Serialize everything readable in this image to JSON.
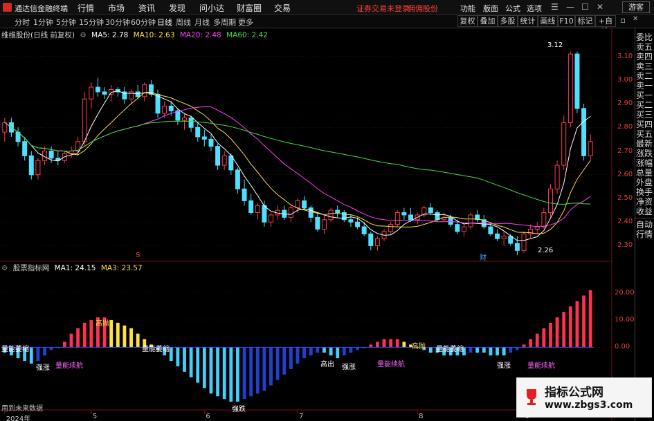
{
  "titlebar": {
    "app_title": "通达信金融终端",
    "menus": [
      "行情",
      "市场",
      "资讯",
      "发现",
      "问小达",
      "财富圈",
      "交易"
    ],
    "warning": "证券交易未登录",
    "broker": "佣佣股份",
    "right_menus": [
      "功能",
      "版面",
      "公式",
      "选项"
    ],
    "guest": "游客"
  },
  "toolbar": {
    "periods": [
      "分时",
      "1分钟",
      "5分钟",
      "15分钟",
      "30分钟",
      "60分钟",
      "日线",
      "周线",
      "月线",
      "多周期",
      "更多"
    ],
    "active_period": "日线",
    "buttons": [
      "复权",
      "叠加",
      "多股",
      "统计",
      "画线",
      "F10",
      "标记",
      "+自选"
    ]
  },
  "main_legend": {
    "stock": "维维股份(日线 前复权)",
    "ma5": "MA5: 2.78",
    "ma10": "MA10: 2.63",
    "ma20": "MA20: 2.48",
    "ma60": "MA60: 2.42"
  },
  "sub_legend": {
    "name": "股票指标网",
    "ma1": "MA1: 24.15",
    "ma3": "MA3: 23.57"
  },
  "price_axis": [
    "3.10",
    "3.00",
    "2.90",
    "2.80",
    "2.70",
    "2.60",
    "2.50",
    "2.40",
    "2.30"
  ],
  "indicator_axis": [
    "20.00",
    "10.00",
    "0.00"
  ],
  "date_axis": [
    "2024年",
    "5",
    "6",
    "7",
    "8",
    "9"
  ],
  "annotations": {
    "high": "3.12",
    "low": "2.26",
    "mark_s": "S",
    "mark_cai": "财",
    "bottom_note": "用到未来数据"
  },
  "indicator_labels": [
    {
      "text": "量能萎缩",
      "color": "#ffffff"
    },
    {
      "text": "强涨",
      "color": "#ffffff"
    },
    {
      "text": "量能续航",
      "color": "#ff60ff"
    },
    {
      "text": "高抛",
      "color": "#ffe040"
    },
    {
      "text": "量能萎缩",
      "color": "#ffffff"
    },
    {
      "text": "强跌",
      "color": "#ffffff"
    },
    {
      "text": "高出",
      "color": "#ffffff"
    },
    {
      "text": "强涨",
      "color": "#ffffff"
    },
    {
      "text": "量能续航",
      "color": "#ff60ff"
    },
    {
      "text": "高抛",
      "color": "#ffe040"
    },
    {
      "text": "量能萎缩",
      "color": "#ffffff"
    },
    {
      "text": "强涨",
      "color": "#ffffff"
    },
    {
      "text": "量能续航",
      "color": "#ff60ff"
    }
  ],
  "side_tabs_top": [
    "委比",
    "卖五",
    "卖四",
    "卖三",
    "卖二",
    "卖一",
    "买一",
    "买二",
    "买三",
    "买四",
    "买五",
    "最新",
    "涨跌",
    "涨幅",
    "总量",
    "外盘",
    "换手",
    "净资",
    "收益"
  ],
  "side_tabs_bottom": [
    "自动",
    "行情"
  ],
  "watermark": {
    "line1": "指标公式网",
    "line2": "www.zbgs3.com"
  },
  "colors": {
    "up": "#ff3a4f",
    "down": "#50e0ff",
    "ma5": "#ffffff",
    "ma10": "#ffe040",
    "ma20": "#ff40ff",
    "ma60": "#40e040",
    "bar_red": "#ff3050",
    "bar_yellow": "#ffe040",
    "bar_cyan": "#40d0ff",
    "bar_blue": "#2040d0",
    "grid": "#7a1010"
  },
  "chart_data": {
    "type": "candlestick",
    "price_range": [
      2.24,
      3.16
    ],
    "candles_ohlc": [
      [
        2.78,
        2.84,
        2.74,
        2.82
      ],
      [
        2.82,
        2.84,
        2.76,
        2.78
      ],
      [
        2.78,
        2.8,
        2.72,
        2.74
      ],
      [
        2.74,
        2.76,
        2.66,
        2.68
      ],
      [
        2.68,
        2.7,
        2.58,
        2.6
      ],
      [
        2.6,
        2.67,
        2.58,
        2.66
      ],
      [
        2.66,
        2.72,
        2.64,
        2.7
      ],
      [
        2.7,
        2.72,
        2.65,
        2.67
      ],
      [
        2.67,
        2.7,
        2.64,
        2.66
      ],
      [
        2.66,
        2.7,
        2.65,
        2.69
      ],
      [
        2.69,
        2.72,
        2.67,
        2.7
      ],
      [
        2.7,
        2.76,
        2.68,
        2.74
      ],
      [
        2.74,
        2.95,
        2.72,
        2.92
      ],
      [
        2.92,
        2.99,
        2.88,
        2.97
      ],
      [
        2.97,
        3.01,
        2.93,
        2.95
      ],
      [
        2.95,
        2.97,
        2.92,
        2.94
      ],
      [
        2.94,
        2.98,
        2.91,
        2.96
      ],
      [
        2.96,
        2.97,
        2.93,
        2.95
      ],
      [
        2.95,
        2.97,
        2.9,
        2.92
      ],
      [
        2.92,
        2.96,
        2.9,
        2.95
      ],
      [
        2.95,
        2.98,
        2.92,
        2.93
      ],
      [
        2.93,
        2.99,
        2.91,
        2.98
      ],
      [
        2.98,
        3.0,
        2.93,
        2.94
      ],
      [
        2.94,
        2.96,
        2.84,
        2.86
      ],
      [
        2.86,
        2.91,
        2.84,
        2.89
      ],
      [
        2.89,
        2.91,
        2.85,
        2.87
      ],
      [
        2.87,
        2.88,
        2.81,
        2.83
      ],
      [
        2.83,
        2.86,
        2.79,
        2.84
      ],
      [
        2.84,
        2.85,
        2.78,
        2.8
      ],
      [
        2.8,
        2.82,
        2.74,
        2.76
      ],
      [
        2.76,
        2.79,
        2.72,
        2.75
      ],
      [
        2.75,
        2.77,
        2.7,
        2.72
      ],
      [
        2.72,
        2.73,
        2.62,
        2.64
      ],
      [
        2.64,
        2.7,
        2.62,
        2.68
      ],
      [
        2.68,
        2.69,
        2.6,
        2.62
      ],
      [
        2.62,
        2.63,
        2.52,
        2.54
      ],
      [
        2.54,
        2.58,
        2.47,
        2.49
      ],
      [
        2.49,
        2.52,
        2.43,
        2.44
      ],
      [
        2.44,
        2.48,
        2.41,
        2.47
      ],
      [
        2.47,
        2.49,
        2.38,
        2.4
      ],
      [
        2.4,
        2.44,
        2.38,
        2.43
      ],
      [
        2.43,
        2.47,
        2.41,
        2.45
      ],
      [
        2.45,
        2.47,
        2.41,
        2.42
      ],
      [
        2.42,
        2.47,
        2.4,
        2.46
      ],
      [
        2.46,
        2.5,
        2.44,
        2.49
      ],
      [
        2.49,
        2.51,
        2.45,
        2.46
      ],
      [
        2.46,
        2.47,
        2.4,
        2.42
      ],
      [
        2.42,
        2.44,
        2.36,
        2.37
      ],
      [
        2.37,
        2.43,
        2.35,
        2.41
      ],
      [
        2.41,
        2.46,
        2.4,
        2.45
      ],
      [
        2.45,
        2.47,
        2.42,
        2.44
      ],
      [
        2.44,
        2.45,
        2.4,
        2.41
      ],
      [
        2.41,
        2.43,
        2.38,
        2.4
      ],
      [
        2.4,
        2.42,
        2.37,
        2.38
      ],
      [
        2.38,
        2.4,
        2.34,
        2.35
      ],
      [
        2.35,
        2.36,
        2.28,
        2.3
      ],
      [
        2.3,
        2.34,
        2.28,
        2.33
      ],
      [
        2.33,
        2.37,
        2.32,
        2.36
      ],
      [
        2.36,
        2.4,
        2.35,
        2.39
      ],
      [
        2.39,
        2.45,
        2.38,
        2.44
      ],
      [
        2.44,
        2.46,
        2.41,
        2.43
      ],
      [
        2.43,
        2.46,
        2.4,
        2.41
      ],
      [
        2.41,
        2.44,
        2.39,
        2.43
      ],
      [
        2.43,
        2.47,
        2.42,
        2.46
      ],
      [
        2.46,
        2.48,
        2.43,
        2.44
      ],
      [
        2.44,
        2.45,
        2.4,
        2.41
      ],
      [
        2.41,
        2.44,
        2.4,
        2.42
      ],
      [
        2.42,
        2.43,
        2.38,
        2.39
      ],
      [
        2.39,
        2.41,
        2.35,
        2.36
      ],
      [
        2.36,
        2.39,
        2.34,
        2.38
      ],
      [
        2.38,
        2.44,
        2.37,
        2.43
      ],
      [
        2.43,
        2.45,
        2.4,
        2.41
      ],
      [
        2.41,
        2.43,
        2.37,
        2.38
      ],
      [
        2.38,
        2.4,
        2.34,
        2.35
      ],
      [
        2.35,
        2.37,
        2.32,
        2.33
      ],
      [
        2.33,
        2.36,
        2.3,
        2.34
      ],
      [
        2.34,
        2.35,
        2.3,
        2.31
      ],
      [
        2.31,
        2.34,
        2.26,
        2.28
      ],
      [
        2.28,
        2.36,
        2.27,
        2.35
      ],
      [
        2.35,
        2.39,
        2.33,
        2.37
      ],
      [
        2.37,
        2.4,
        2.35,
        2.38
      ],
      [
        2.38,
        2.46,
        2.37,
        2.44
      ],
      [
        2.44,
        2.56,
        2.42,
        2.54
      ],
      [
        2.54,
        2.66,
        2.52,
        2.64
      ],
      [
        2.64,
        2.85,
        2.62,
        2.82
      ],
      [
        2.82,
        3.12,
        2.8,
        3.11
      ],
      [
        3.11,
        3.12,
        2.86,
        2.88
      ],
      [
        2.88,
        2.9,
        2.66,
        2.68
      ],
      [
        2.68,
        2.77,
        2.66,
        2.74
      ]
    ],
    "indicator": [
      -2,
      -3,
      -4,
      -5,
      -6,
      -5,
      -3,
      -1,
      0,
      2,
      5,
      7,
      9,
      10,
      11,
      11,
      10,
      9,
      8,
      7,
      5,
      3,
      1,
      -1,
      -3,
      -5,
      -7,
      -9,
      -11,
      -13,
      -15,
      -17,
      -18,
      -19,
      -20,
      -20,
      -19,
      -18,
      -17,
      -16,
      -14,
      -12,
      -10,
      -8,
      -6,
      -4,
      -3,
      -2,
      -2,
      -3,
      -4,
      -3,
      -2,
      -1,
      0,
      1,
      2,
      3,
      3,
      3,
      2,
      1,
      0,
      -1,
      -2,
      -2,
      -3,
      -3,
      -3,
      -3,
      -2,
      -2,
      -2,
      -3,
      -3,
      -3,
      -2,
      -1,
      1,
      3,
      5,
      7,
      9,
      11,
      13,
      15,
      17,
      19,
      21,
      23,
      24
    ],
    "indicator_range": [
      -22,
      27
    ]
  }
}
